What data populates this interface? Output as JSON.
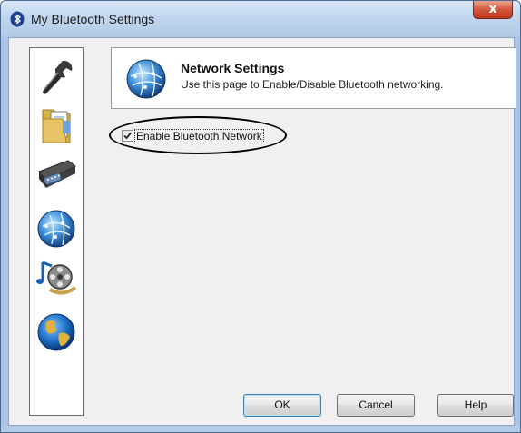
{
  "window": {
    "title": "My Bluetooth Settings",
    "close_label": "x",
    "accent_color": "#c2351d"
  },
  "sidebar": {
    "items": [
      {
        "icon": "wrench-icon",
        "label": "General"
      },
      {
        "icon": "folder-share-icon",
        "label": "File Transfer"
      },
      {
        "icon": "serial-port-icon",
        "label": "Serial Port"
      },
      {
        "icon": "network-globe-icon",
        "label": "Network"
      },
      {
        "icon": "music-film-icon",
        "label": "Audio/Video"
      },
      {
        "icon": "earth-icon",
        "label": "Internet"
      }
    ]
  },
  "header": {
    "title": "Network Settings",
    "description": "Use this page to Enable/Disable Bluetooth networking."
  },
  "options": {
    "enable_network_label": "Enable Bluetooth Network",
    "enable_network_checked": true
  },
  "buttons": {
    "ok": "OK",
    "cancel": "Cancel",
    "help": "Help"
  }
}
